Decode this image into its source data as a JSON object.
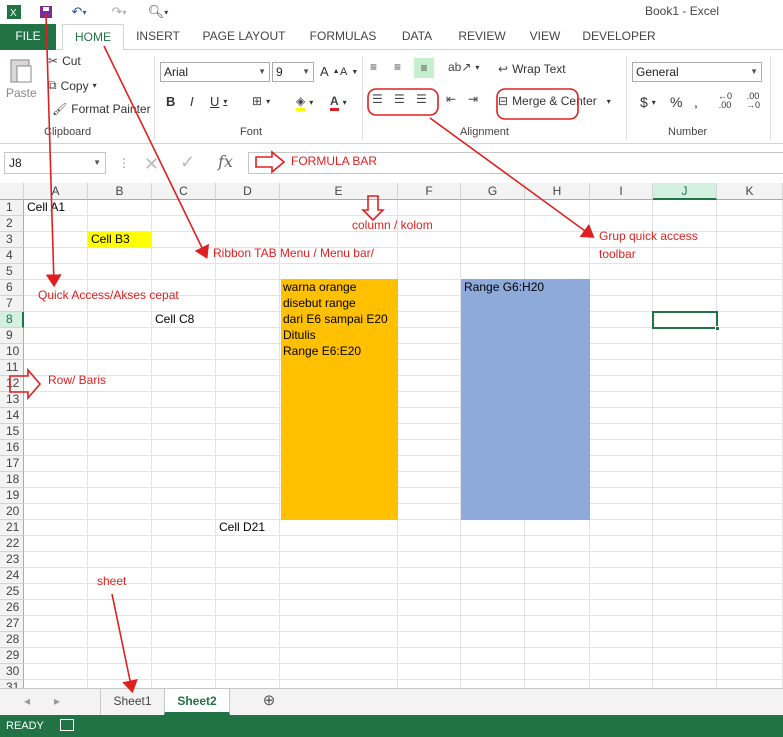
{
  "titlebar": {
    "title": "Book1 - Excel"
  },
  "tabs": [
    "FILE",
    "HOME",
    "INSERT",
    "PAGE LAYOUT",
    "FORMULAS",
    "DATA",
    "REVIEW",
    "VIEW",
    "DEVELOPER"
  ],
  "ribbon": {
    "clipboard": {
      "paste": "Paste",
      "cut": "Cut",
      "copy": "Copy",
      "format_painter": "Format Painter",
      "label": "Clipboard"
    },
    "font": {
      "name": "Arial",
      "size": "9",
      "label": "Font"
    },
    "alignment": {
      "wrap": "Wrap Text",
      "merge": "Merge & Center",
      "label": "Alignment"
    },
    "number": {
      "format": "General",
      "label": "Number"
    }
  },
  "formula_bar": {
    "name_box": "J8",
    "fx": "fx"
  },
  "columns": [
    "A",
    "B",
    "C",
    "D",
    "E",
    "F",
    "G",
    "H",
    "I",
    "J",
    "K"
  ],
  "rows": [
    "1",
    "2",
    "3",
    "4",
    "5",
    "6",
    "7",
    "8",
    "9",
    "10",
    "11",
    "12",
    "13",
    "14",
    "15",
    "16",
    "17",
    "18",
    "19",
    "20",
    "21",
    "22",
    "23",
    "24",
    "25",
    "26",
    "27",
    "28",
    "29",
    "30",
    "31"
  ],
  "cells": {
    "A1": "Cell A1",
    "B3": "Cell B3",
    "C8": "Cell C8",
    "D21": "Cell D21",
    "E6": "warna orange",
    "E7": "disebut range",
    "E8": "dari E6 sampai E20",
    "E9": "Ditulis",
    "E10": "Range E6:E20",
    "G6": "Range G6:H20"
  },
  "sheets": [
    "Sheet1",
    "Sheet2"
  ],
  "status": {
    "text": "READY"
  },
  "annotations": {
    "formula_bar": "FORMULA BAR",
    "column": "column / kolom",
    "grup_line1": "Grup quick access",
    "grup_line2": "toolbar",
    "ribbon": "Ribbon TAB Menu / Menu bar/",
    "quick_access": "Quick Access/Akses cepat",
    "row": "Row/ Baris",
    "sheet": "sheet"
  },
  "colors": {
    "excel_green": "#217346",
    "orange": "#ffc000",
    "blue": "#8eaadb",
    "yellow": "#ffff00",
    "annotation": "#e02020"
  }
}
